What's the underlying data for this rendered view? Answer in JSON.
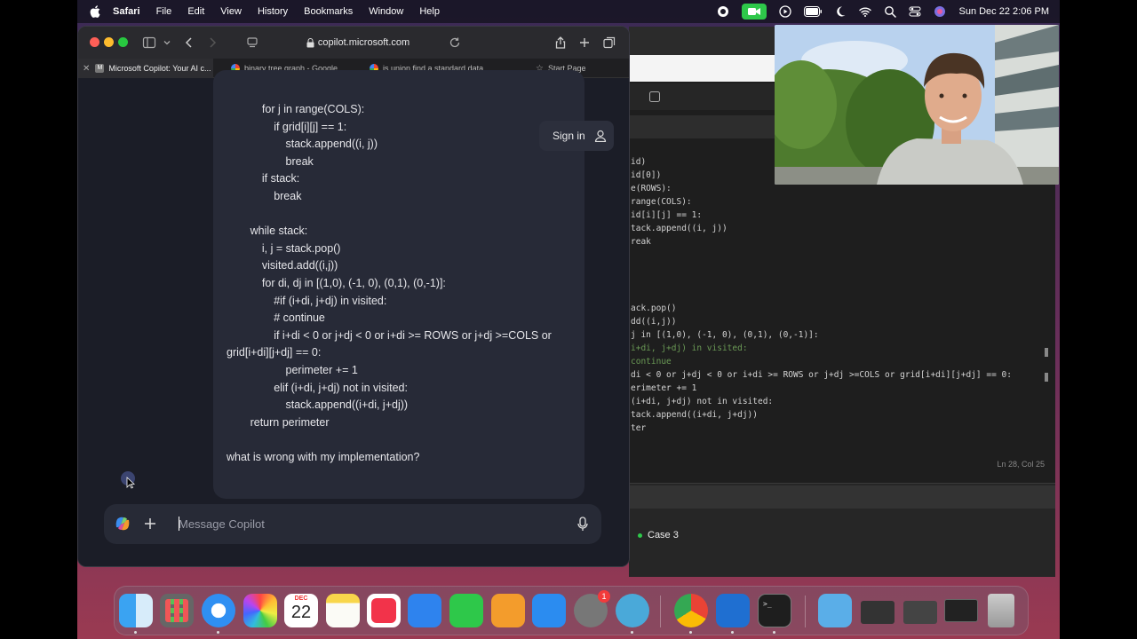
{
  "menubar": {
    "app": "Safari",
    "items": [
      "File",
      "Edit",
      "View",
      "History",
      "Bookmarks",
      "Window",
      "Help"
    ],
    "datetime": "Sun Dec 22  2:06 PM"
  },
  "safari": {
    "url": "copilot.microsoft.com",
    "tabs": [
      {
        "label": "Microsoft Copilot: Your AI c...",
        "favicon": "M"
      },
      {
        "label": "binary tree graph - Google..."
      },
      {
        "label": "is union find a standard data..."
      },
      {
        "label": "Start Page"
      }
    ]
  },
  "copilot": {
    "sign_in": "Sign in",
    "composer_placeholder": "Message Copilot",
    "code_lines": [
      {
        "indent": 3,
        "text": "for j in range(COLS):"
      },
      {
        "indent": 4,
        "text": "if grid[i][j] == 1:"
      },
      {
        "indent": 5,
        "text": "stack.append((i, j))"
      },
      {
        "indent": 5,
        "text": "break"
      },
      {
        "indent": 3,
        "text": "if stack:"
      },
      {
        "indent": 4,
        "text": "break"
      },
      {
        "indent": 0,
        "text": ""
      },
      {
        "indent": 2,
        "text": "while stack:"
      },
      {
        "indent": 3,
        "text": "i, j = stack.pop()"
      },
      {
        "indent": 3,
        "text": "visited.add((i,j))"
      },
      {
        "indent": 3,
        "text": "for di, dj in [(1,0), (-1, 0), (0,1), (0,-1)]:"
      },
      {
        "indent": 4,
        "text": "#if (i+di, j+dj) in visited:"
      },
      {
        "indent": 4,
        "text": "#    continue"
      },
      {
        "indent": 4,
        "text": "if i+di < 0 or j+dj < 0 or i+di >= ROWS or j+dj >=COLS or"
      },
      {
        "indent": 0,
        "text": "grid[i+di][j+dj] == 0:"
      },
      {
        "indent": 5,
        "text": "perimeter += 1"
      },
      {
        "indent": 4,
        "text": "elif (i+di, j+dj) not in visited:"
      },
      {
        "indent": 5,
        "text": "stack.append((i+di, j+dj))"
      },
      {
        "indent": 2,
        "text": "return perimeter"
      },
      {
        "indent": 0,
        "text": ""
      },
      {
        "indent": 0,
        "text": "what is wrong with my implementation?"
      }
    ]
  },
  "editor": {
    "lines": [
      "id)",
      "id[0])",
      "e(ROWS):",
      "range(COLS):",
      "id[i][j] == 1:",
      "tack.append((i, j))",
      "reak",
      "",
      "",
      "",
      "",
      "ack.pop()",
      "dd((i,j))",
      "j in [(1,0), (-1, 0), (0,1), (0,-1)]:",
      "i+di, j+dj) in visited:",
      "continue",
      "di < 0 or j+dj < 0 or i+di >= ROWS or j+dj >=COLS or grid[i+di][j+dj] == 0:",
      "erimeter += 1",
      "(i+di, j+dj) not in visited:",
      "tack.append((i+di, j+dj))",
      "ter"
    ],
    "status": "Ln 28, Col 25",
    "case_label": "Case 3"
  },
  "dock": {
    "calendar_month": "DEC",
    "calendar_day": "22",
    "badge": "1"
  }
}
